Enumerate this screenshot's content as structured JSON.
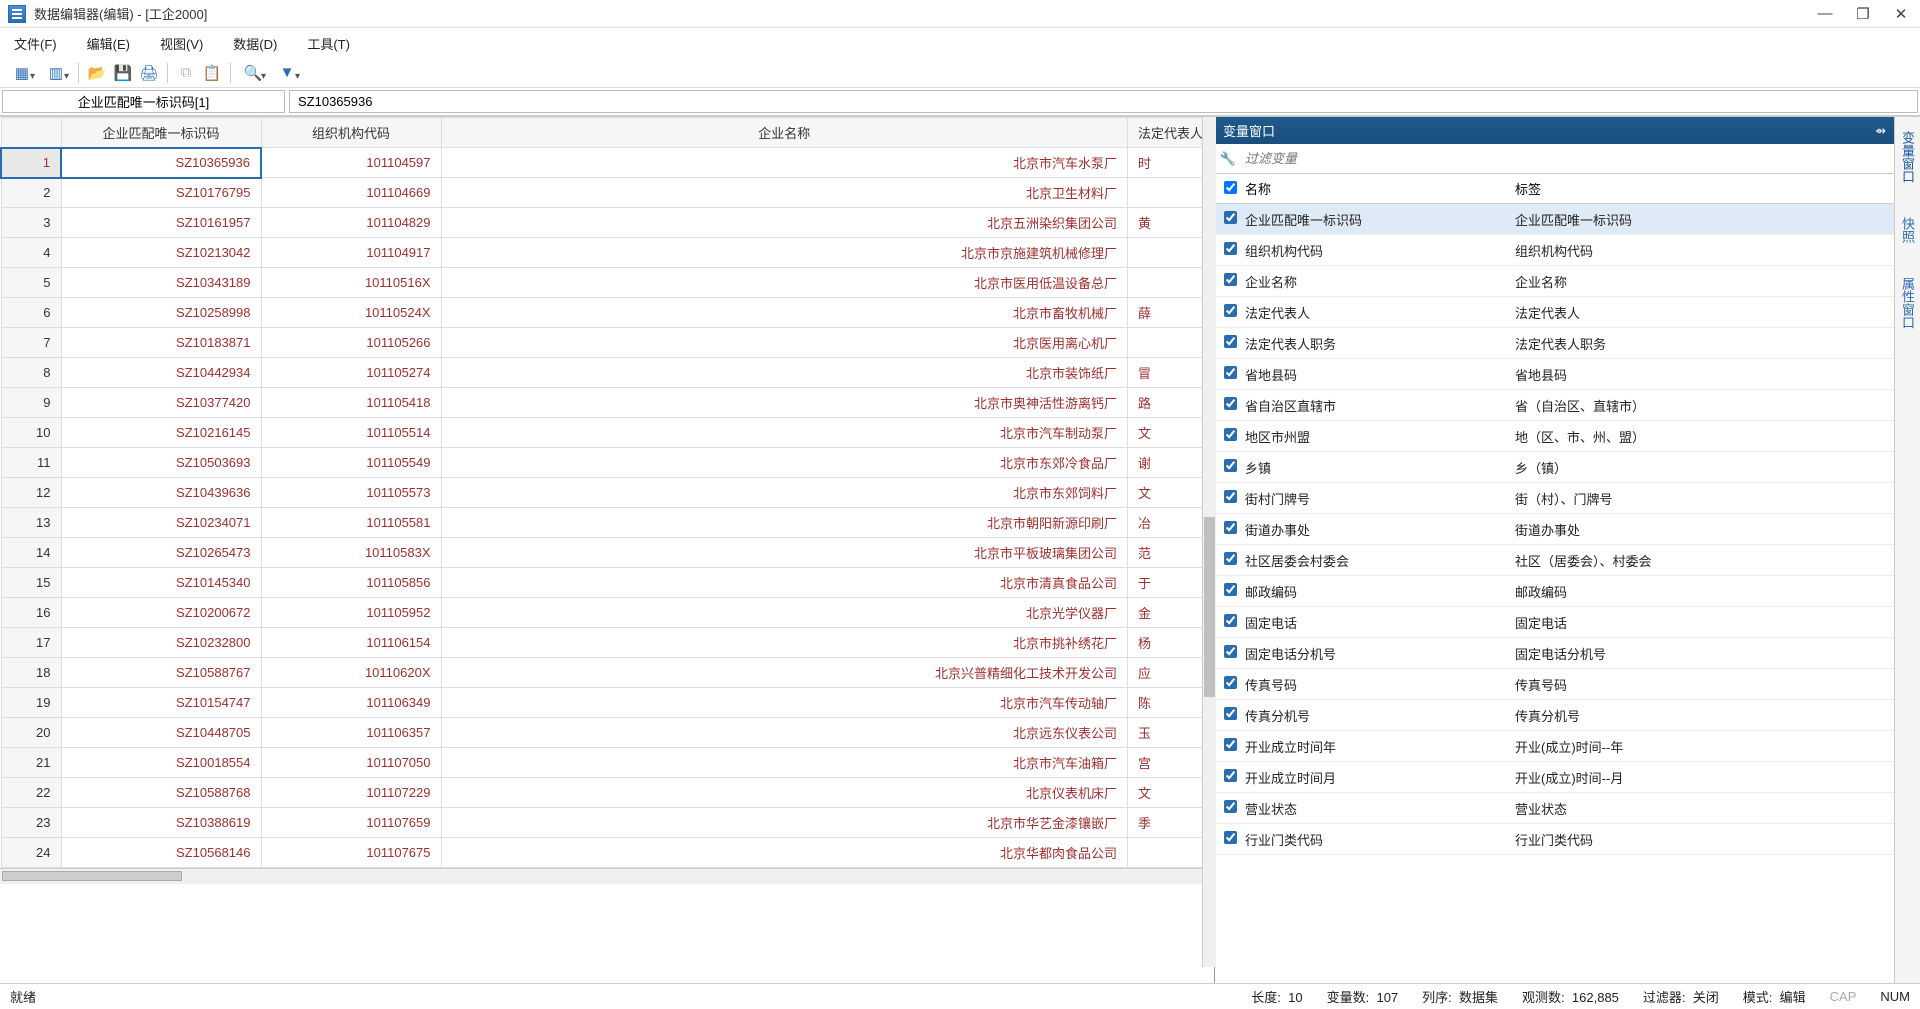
{
  "window": {
    "title": "数据编辑器(编辑) - [工企2000]"
  },
  "menu": {
    "file": "文件(F)",
    "edit": "编辑(E)",
    "view": "视图(V)",
    "data": "数据(D)",
    "tools": "工具(T)"
  },
  "inputRow": {
    "colLabel": "企业匹配唯一标识码[1]",
    "value": "SZ10365936"
  },
  "grid": {
    "headers": {
      "rownum": "",
      "id": "企业匹配唯一标识码",
      "orgcode": "组织机构代码",
      "company": "企业名称",
      "legal": "法定代表人"
    },
    "rows": [
      {
        "n": 1,
        "id": "SZ10365936",
        "org": "101104597",
        "co": "北京市汽车水泵厂",
        "lg": "时"
      },
      {
        "n": 2,
        "id": "SZ10176795",
        "org": "101104669",
        "co": "北京卫生材料厂",
        "lg": ""
      },
      {
        "n": 3,
        "id": "SZ10161957",
        "org": "101104829",
        "co": "北京五洲染织集团公司",
        "lg": "黄"
      },
      {
        "n": 4,
        "id": "SZ10213042",
        "org": "101104917",
        "co": "北京市京施建筑机械修理厂",
        "lg": ""
      },
      {
        "n": 5,
        "id": "SZ10343189",
        "org": "10110516X",
        "co": "北京市医用低温设备总厂",
        "lg": ""
      },
      {
        "n": 6,
        "id": "SZ10258998",
        "org": "10110524X",
        "co": "北京市畜牧机械厂",
        "lg": "薛"
      },
      {
        "n": 7,
        "id": "SZ10183871",
        "org": "101105266",
        "co": "北京医用离心机厂",
        "lg": ""
      },
      {
        "n": 8,
        "id": "SZ10442934",
        "org": "101105274",
        "co": "北京市装饰纸厂",
        "lg": "冒"
      },
      {
        "n": 9,
        "id": "SZ10377420",
        "org": "101105418",
        "co": "北京市奥神活性游离钙厂",
        "lg": "路"
      },
      {
        "n": 10,
        "id": "SZ10216145",
        "org": "101105514",
        "co": "北京市汽车制动泵厂",
        "lg": "文"
      },
      {
        "n": 11,
        "id": "SZ10503693",
        "org": "101105549",
        "co": "北京市东郊冷食品厂",
        "lg": "谢"
      },
      {
        "n": 12,
        "id": "SZ10439636",
        "org": "101105573",
        "co": "北京市东郊饲料厂",
        "lg": "文"
      },
      {
        "n": 13,
        "id": "SZ10234071",
        "org": "101105581",
        "co": "北京市朝阳新源印刷厂",
        "lg": "冶"
      },
      {
        "n": 14,
        "id": "SZ10265473",
        "org": "10110583X",
        "co": "北京市平板玻璃集团公司",
        "lg": "范"
      },
      {
        "n": 15,
        "id": "SZ10145340",
        "org": "101105856",
        "co": "北京市清真食品公司",
        "lg": "于"
      },
      {
        "n": 16,
        "id": "SZ10200672",
        "org": "101105952",
        "co": "北京光学仪器厂",
        "lg": "金"
      },
      {
        "n": 17,
        "id": "SZ10232800",
        "org": "101106154",
        "co": "北京市挑补绣花厂",
        "lg": "杨"
      },
      {
        "n": 18,
        "id": "SZ10588767",
        "org": "10110620X",
        "co": "北京兴普精细化工技术开发公司",
        "lg": "应"
      },
      {
        "n": 19,
        "id": "SZ10154747",
        "org": "101106349",
        "co": "北京市汽车传动轴厂",
        "lg": "陈"
      },
      {
        "n": 20,
        "id": "SZ10448705",
        "org": "101106357",
        "co": "北京远东仪表公司",
        "lg": "玉"
      },
      {
        "n": 21,
        "id": "SZ10018554",
        "org": "101107050",
        "co": "北京市汽车油箱厂",
        "lg": "宫"
      },
      {
        "n": 22,
        "id": "SZ10588768",
        "org": "101107229",
        "co": "北京仪表机床厂",
        "lg": "文"
      },
      {
        "n": 23,
        "id": "SZ10388619",
        "org": "101107659",
        "co": "北京市华艺金漆镶嵌厂",
        "lg": "季"
      },
      {
        "n": 24,
        "id": "SZ10568146",
        "org": "101107675",
        "co": "北京华都肉食品公司",
        "lg": ""
      }
    ]
  },
  "varPanel": {
    "title": "变量窗口",
    "filterPlaceholder": "过滤变量",
    "headers": {
      "name": "名称",
      "label": "标签"
    },
    "vars": [
      {
        "name": "企业匹配唯一标识码",
        "label": "企业匹配唯一标识码",
        "sel": true
      },
      {
        "name": "组织机构代码",
        "label": "组织机构代码"
      },
      {
        "name": "企业名称",
        "label": "企业名称"
      },
      {
        "name": "法定代表人",
        "label": "法定代表人"
      },
      {
        "name": "法定代表人职务",
        "label": "法定代表人职务"
      },
      {
        "name": "省地县码",
        "label": "省地县码"
      },
      {
        "name": "省自治区直辖市",
        "label": "省（自治区、直辖市）"
      },
      {
        "name": "地区市州盟",
        "label": "地（区、市、州、盟）"
      },
      {
        "name": "乡镇",
        "label": "乡（镇）"
      },
      {
        "name": "街村门牌号",
        "label": "街（村）、门牌号"
      },
      {
        "name": "街道办事处",
        "label": "街道办事处"
      },
      {
        "name": "社区居委会村委会",
        "label": "社区（居委会）、村委会"
      },
      {
        "name": "邮政编码",
        "label": "邮政编码"
      },
      {
        "name": "固定电话",
        "label": "固定电话"
      },
      {
        "name": "固定电话分机号",
        "label": "固定电话分机号"
      },
      {
        "name": "传真号码",
        "label": "传真号码"
      },
      {
        "name": "传真分机号",
        "label": "传真分机号"
      },
      {
        "name": "开业成立时间年",
        "label": "开业(成立)时间--年"
      },
      {
        "name": "开业成立时间月",
        "label": "开业(成立)时间--月"
      },
      {
        "name": "营业状态",
        "label": "营业状态"
      },
      {
        "name": "行业门类代码",
        "label": "行业门类代码"
      }
    ]
  },
  "sideTabs": {
    "t1": "变量窗口",
    "t2": "快照",
    "t3": "属性窗口"
  },
  "status": {
    "ready": "就绪",
    "length_lbl": "长度:",
    "length_val": "10",
    "vars_lbl": "变量数:",
    "vars_val": "107",
    "sort_lbl": "列序:",
    "sort_val": "数据集",
    "obs_lbl": "观测数:",
    "obs_val": "162,885",
    "filter_lbl": "过滤器:",
    "filter_val": "关闭",
    "mode_lbl": "模式:",
    "mode_val": "编辑",
    "cap": "CAP",
    "num": "NUM"
  }
}
